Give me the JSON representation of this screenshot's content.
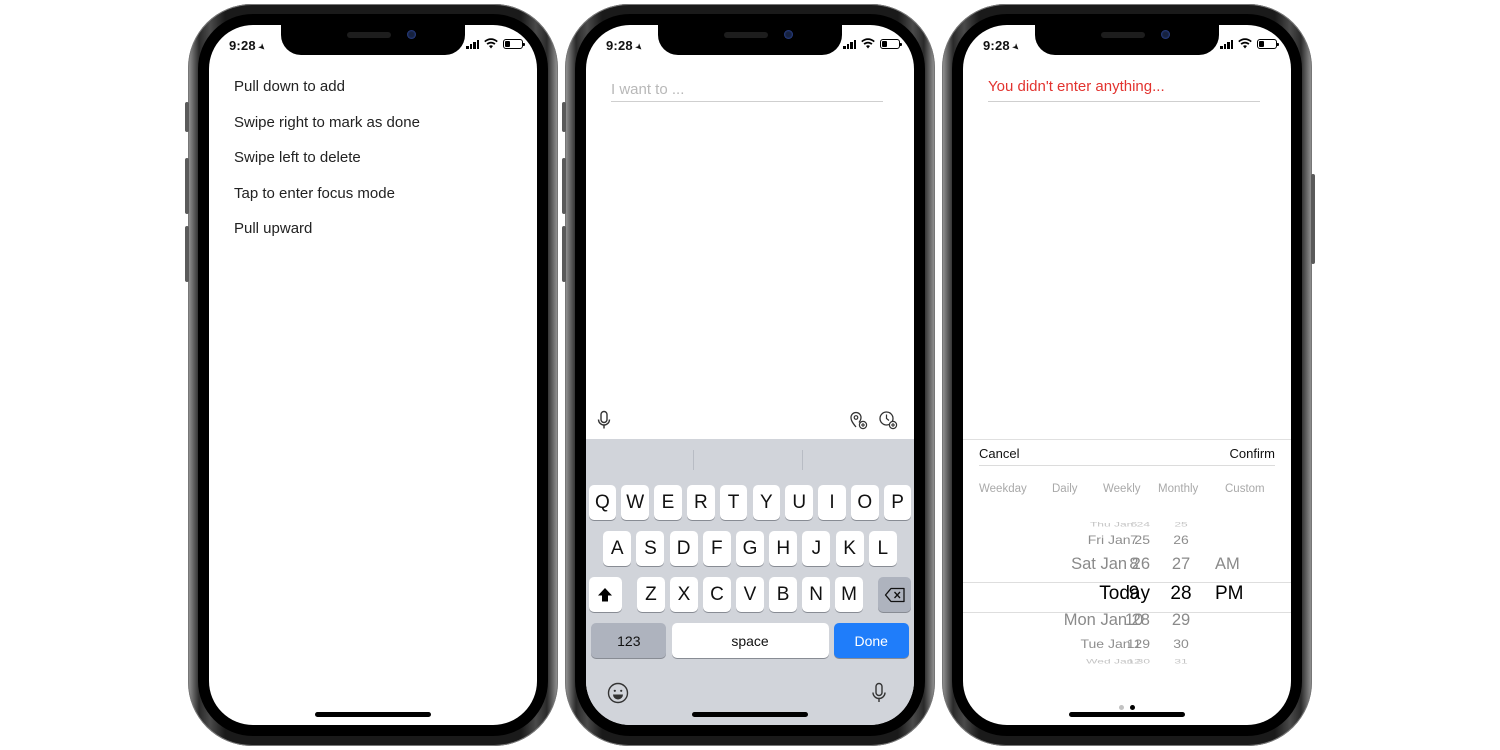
{
  "status": {
    "time": "9:28"
  },
  "phone1": {
    "hints": [
      "Pull down to add",
      "Swipe right to mark as done",
      "Swipe left to delete",
      "Tap to enter focus mode",
      "Pull upward"
    ]
  },
  "phone2": {
    "input": {
      "placeholder": "I want to ...",
      "value": ""
    },
    "accessory": {
      "left_icon": "microphone-icon",
      "right_icons": [
        "location-reminder-icon",
        "time-reminder-icon"
      ]
    },
    "keyboard": {
      "row1": [
        "Q",
        "W",
        "E",
        "R",
        "T",
        "Y",
        "U",
        "I",
        "O",
        "P"
      ],
      "row2": [
        "A",
        "S",
        "D",
        "F",
        "G",
        "H",
        "J",
        "K",
        "L"
      ],
      "row3": [
        "Z",
        "X",
        "C",
        "V",
        "B",
        "N",
        "M"
      ],
      "num_label": "123",
      "space_label": "space",
      "done_label": "Done",
      "icons": [
        "shift-icon",
        "backspace-icon",
        "emoji-icon",
        "dictation-icon"
      ]
    }
  },
  "phone3": {
    "error_text": "You didn't enter anything...",
    "picker": {
      "cancel_label": "Cancel",
      "confirm_label": "Confirm",
      "repeat_options": [
        "Weekday",
        "Daily",
        "Weekly",
        "Monthly",
        "Custom"
      ],
      "wheel_rows": [
        {
          "day": "Thu Jan 24",
          "hour": "6",
          "minute": "25",
          "ampm": ""
        },
        {
          "day": "Fri Jan 25",
          "hour": "7",
          "minute": "26",
          "ampm": ""
        },
        {
          "day": "Sat Jan 26",
          "hour": "8",
          "minute": "27",
          "ampm": "AM"
        },
        {
          "day": "Today",
          "hour": "9",
          "minute": "28",
          "ampm": "PM"
        },
        {
          "day": "Mon Jan 28",
          "hour": "10",
          "minute": "29",
          "ampm": ""
        },
        {
          "day": "Tue Jan 29",
          "hour": "11",
          "minute": "30",
          "ampm": ""
        },
        {
          "day": "Wed Jan 30",
          "hour": "12",
          "minute": "31",
          "ampm": ""
        }
      ],
      "page_count": 2,
      "active_page": 2
    }
  }
}
